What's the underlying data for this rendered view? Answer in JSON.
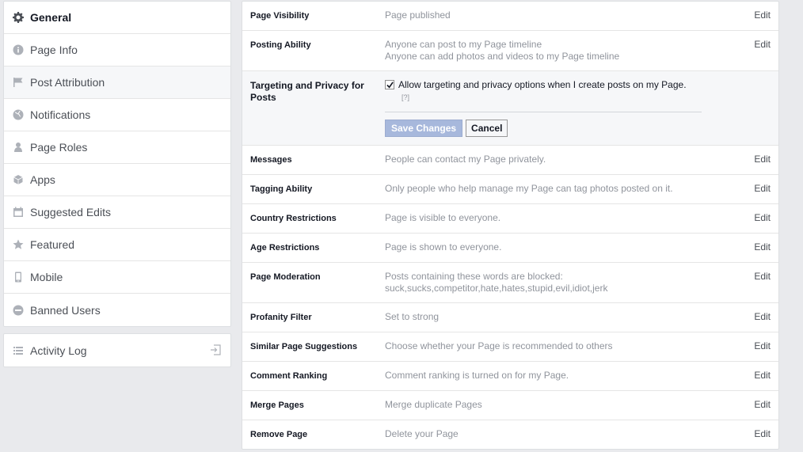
{
  "sidebar": {
    "items": [
      {
        "label": "General",
        "icon": "gear-icon"
      },
      {
        "label": "Page Info",
        "icon": "info-icon"
      },
      {
        "label": "Post Attribution",
        "icon": "flag-icon"
      },
      {
        "label": "Notifications",
        "icon": "globe-icon"
      },
      {
        "label": "Page Roles",
        "icon": "person-icon"
      },
      {
        "label": "Apps",
        "icon": "cube-icon"
      },
      {
        "label": "Suggested Edits",
        "icon": "calendar-icon"
      },
      {
        "label": "Featured",
        "icon": "star-icon"
      },
      {
        "label": "Mobile",
        "icon": "phone-icon"
      },
      {
        "label": "Banned Users",
        "icon": "ban-icon"
      }
    ],
    "activity_log": "Activity Log"
  },
  "settings": {
    "edit_label": "Edit",
    "rows": [
      {
        "label": "Page Visibility",
        "value": "Page published",
        "value2": ""
      },
      {
        "label": "Posting Ability",
        "value": "Anyone can post to my Page timeline",
        "value2": "Anyone can add photos and videos to my Page timeline"
      },
      {
        "label": "Messages",
        "value": "People can contact my Page privately.",
        "value2": ""
      },
      {
        "label": "Tagging Ability",
        "value": "Only people who help manage my Page can tag photos posted on it.",
        "value2": ""
      },
      {
        "label": "Country Restrictions",
        "value": "Page is visible to everyone.",
        "value2": ""
      },
      {
        "label": "Age Restrictions",
        "value": "Page is shown to everyone.",
        "value2": ""
      },
      {
        "label": "Page Moderation",
        "value": "Posts containing these words are blocked:",
        "value2": "suck,sucks,competitor,hate,hates,stupid,evil,idiot,jerk"
      },
      {
        "label": "Profanity Filter",
        "value": "Set to strong",
        "value2": ""
      },
      {
        "label": "Similar Page Suggestions",
        "value": "Choose whether your Page is recommended to others",
        "value2": ""
      },
      {
        "label": "Comment Ranking",
        "value": "Comment ranking is turned on for my Page.",
        "value2": ""
      },
      {
        "label": "Merge Pages",
        "value": "Merge duplicate Pages",
        "value2": ""
      },
      {
        "label": "Remove Page",
        "value": "Delete your Page",
        "value2": ""
      }
    ],
    "targeting": {
      "label": "Targeting and Privacy for Posts",
      "checkbox_label": "Allow targeting and privacy options when I create posts on my Page.",
      "checked": true,
      "help": "[?]",
      "save": "Save Changes",
      "cancel": "Cancel"
    }
  }
}
